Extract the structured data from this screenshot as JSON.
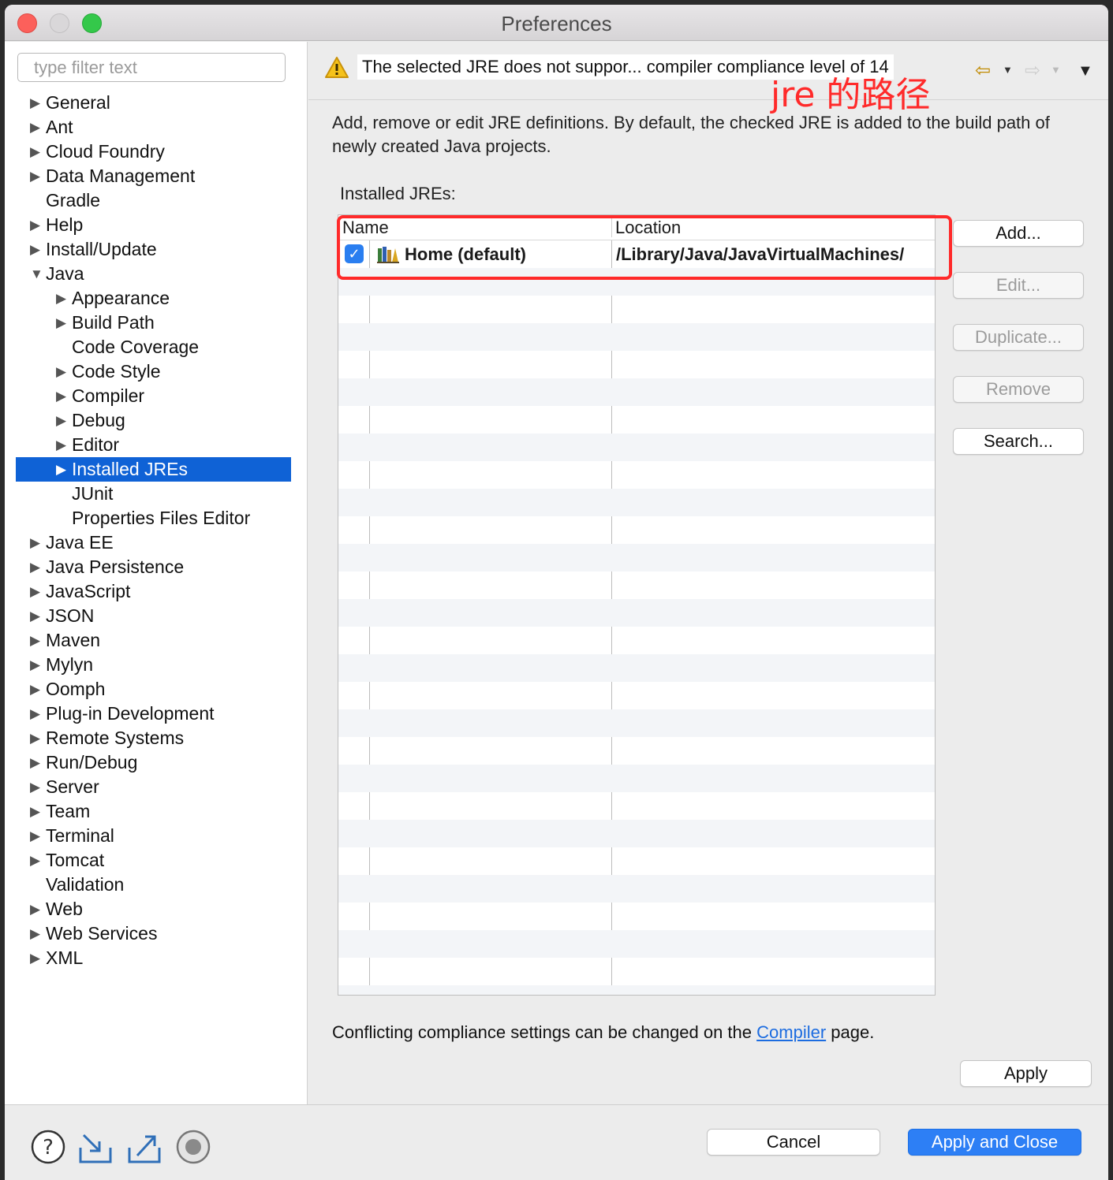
{
  "window": {
    "title": "Preferences"
  },
  "filter": {
    "placeholder": "type filter text"
  },
  "tree": [
    {
      "label": "General",
      "level": 0,
      "arrow": "right"
    },
    {
      "label": "Ant",
      "level": 0,
      "arrow": "right"
    },
    {
      "label": "Cloud Foundry",
      "level": 0,
      "arrow": "right"
    },
    {
      "label": "Data Management",
      "level": 0,
      "arrow": "right"
    },
    {
      "label": "Gradle",
      "level": 0,
      "arrow": "none"
    },
    {
      "label": "Help",
      "level": 0,
      "arrow": "right"
    },
    {
      "label": "Install/Update",
      "level": 0,
      "arrow": "right"
    },
    {
      "label": "Java",
      "level": 0,
      "arrow": "down"
    },
    {
      "label": "Appearance",
      "level": 1,
      "arrow": "right"
    },
    {
      "label": "Build Path",
      "level": 1,
      "arrow": "right"
    },
    {
      "label": "Code Coverage",
      "level": 1,
      "arrow": "none"
    },
    {
      "label": "Code Style",
      "level": 1,
      "arrow": "right"
    },
    {
      "label": "Compiler",
      "level": 1,
      "arrow": "right"
    },
    {
      "label": "Debug",
      "level": 1,
      "arrow": "right"
    },
    {
      "label": "Editor",
      "level": 1,
      "arrow": "right"
    },
    {
      "label": "Installed JREs",
      "level": 1,
      "arrow": "right",
      "selected": true
    },
    {
      "label": "JUnit",
      "level": 1,
      "arrow": "none"
    },
    {
      "label": "Properties Files Editor",
      "level": 1,
      "arrow": "none"
    },
    {
      "label": "Java EE",
      "level": 0,
      "arrow": "right"
    },
    {
      "label": "Java Persistence",
      "level": 0,
      "arrow": "right"
    },
    {
      "label": "JavaScript",
      "level": 0,
      "arrow": "right"
    },
    {
      "label": "JSON",
      "level": 0,
      "arrow": "right"
    },
    {
      "label": "Maven",
      "level": 0,
      "arrow": "right"
    },
    {
      "label": "Mylyn",
      "level": 0,
      "arrow": "right"
    },
    {
      "label": "Oomph",
      "level": 0,
      "arrow": "right"
    },
    {
      "label": "Plug-in Development",
      "level": 0,
      "arrow": "right"
    },
    {
      "label": "Remote Systems",
      "level": 0,
      "arrow": "right"
    },
    {
      "label": "Run/Debug",
      "level": 0,
      "arrow": "right"
    },
    {
      "label": "Server",
      "level": 0,
      "arrow": "right"
    },
    {
      "label": "Team",
      "level": 0,
      "arrow": "right"
    },
    {
      "label": "Terminal",
      "level": 0,
      "arrow": "right"
    },
    {
      "label": "Tomcat",
      "level": 0,
      "arrow": "right"
    },
    {
      "label": "Validation",
      "level": 0,
      "arrow": "none"
    },
    {
      "label": "Web",
      "level": 0,
      "arrow": "right"
    },
    {
      "label": "Web Services",
      "level": 0,
      "arrow": "right"
    },
    {
      "label": "XML",
      "level": 0,
      "arrow": "right"
    }
  ],
  "message": {
    "text": "The selected JRE does not suppor... compiler compliance level of 14"
  },
  "annotation": {
    "text": "jre 的路径",
    "color": "#ff2a2a"
  },
  "page": {
    "description": "Add, remove or edit JRE definitions. By default, the checked JRE is added to the build path of newly created Java projects.",
    "installed_label": "Installed JREs:",
    "columns": {
      "name": "Name",
      "location": "Location"
    },
    "jres": [
      {
        "name": "Home (default)",
        "location": "/Library/Java/JavaVirtualMachines/",
        "checked": true
      }
    ],
    "buttons": {
      "add": "Add...",
      "edit": "Edit...",
      "duplicate": "Duplicate...",
      "remove": "Remove",
      "search": "Search..."
    },
    "conflict_prefix": "Conflicting compliance settings can be changed on the",
    "conflict_link": "Compiler",
    "conflict_suffix": "page.",
    "apply": "Apply"
  },
  "footer": {
    "cancel": "Cancel",
    "apply_close": "Apply and Close"
  },
  "colors": {
    "selection": "#0f62d6",
    "primary_button": "#2d7ff5",
    "link": "#1c6ce0"
  },
  "icons": {
    "back": "back-arrow-icon",
    "forward": "forward-arrow-icon",
    "help": "help-icon",
    "import": "import-icon",
    "export": "export-icon",
    "record": "record-icon"
  }
}
